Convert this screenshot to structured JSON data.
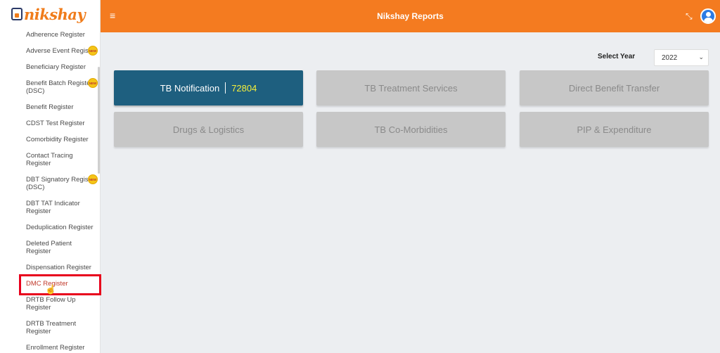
{
  "logo": {
    "text": "nikshay"
  },
  "sidebar": {
    "items": [
      {
        "label": "Adherence Register",
        "new": false
      },
      {
        "label": "Adverse Event Register",
        "new": true
      },
      {
        "label": "Beneficiary Register",
        "new": false
      },
      {
        "label": "Benefit Batch Register (DSC)",
        "new": true
      },
      {
        "label": "Benefit Register",
        "new": false
      },
      {
        "label": "CDST Test Register",
        "new": false
      },
      {
        "label": "Comorbidity Register",
        "new": false
      },
      {
        "label": "Contact Tracing Register",
        "new": false
      },
      {
        "label": "DBT Signatory Register (DSC)",
        "new": true
      },
      {
        "label": "DBT TAT Indicator Register",
        "new": false
      },
      {
        "label": "Deduplication Register",
        "new": false
      },
      {
        "label": "Deleted Patient Register",
        "new": false
      },
      {
        "label": "Dispensation Register",
        "new": false
      },
      {
        "label": "DMC Register",
        "new": false,
        "active": true
      },
      {
        "label": "DRTB Follow Up Register",
        "new": false
      },
      {
        "label": "DRTB Treatment Register",
        "new": false
      },
      {
        "label": "Enrollment Register",
        "new": false
      }
    ],
    "new_badge_text": "NEW"
  },
  "header": {
    "menu_icon": "hamburger-icon",
    "title": "Nikshay Reports",
    "expand_icon": "fullscreen-icon",
    "user_icon": "user-avatar-icon"
  },
  "filters": {
    "year_label": "Select Year",
    "year_value": "2022"
  },
  "tiles": [
    {
      "label": "TB Notification",
      "count": "72804",
      "enabled": true
    },
    {
      "label": "TB Treatment Services",
      "enabled": false
    },
    {
      "label": "Direct Benefit Transfer",
      "enabled": false
    },
    {
      "label": "Drugs & Logistics",
      "enabled": false
    },
    {
      "label": "TB Co-Morbidities",
      "enabled": false
    },
    {
      "label": "PIP & Expenditure",
      "enabled": false
    }
  ],
  "colors": {
    "header": "#f47b20",
    "primary_tile": "#1e5f7f",
    "disabled_tile": "#c7c7c7",
    "count": "#f6ef3b",
    "highlight": "#e8001c"
  }
}
